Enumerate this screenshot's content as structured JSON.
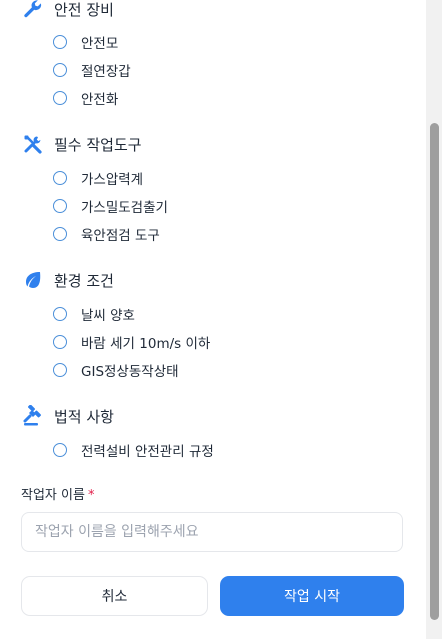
{
  "sections": [
    {
      "title": "안전 장비",
      "icon": "wrench-icon",
      "items": [
        "안전모",
        "절연장갑",
        "안전화"
      ]
    },
    {
      "title": "필수 작업도구",
      "icon": "tools-icon",
      "items": [
        "가스압력계",
        "가스밀도검출기",
        "육안점검 도구"
      ]
    },
    {
      "title": "환경 조건",
      "icon": "leaf-icon",
      "items": [
        "날씨 양호",
        "바람 세기 10m/s 이하",
        "GIS정상동작상태"
      ]
    },
    {
      "title": "법적 사항",
      "icon": "gavel-icon",
      "items": [
        "전력설비 안전관리 규정"
      ]
    }
  ],
  "form": {
    "worker_label": "작업자 이름",
    "required_mark": "*",
    "worker_placeholder": "작업자 이름을 입력해주세요",
    "worker_value": ""
  },
  "buttons": {
    "cancel": "취소",
    "start": "작업 시작"
  },
  "colors": {
    "accent": "#2f80ed",
    "radio_border": "#4b8fd9",
    "required": "#e11d48"
  }
}
